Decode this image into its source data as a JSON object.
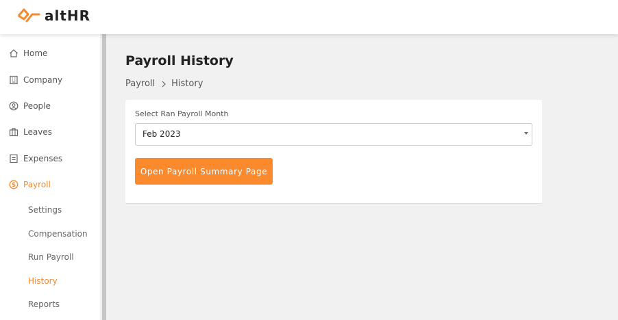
{
  "brand": {
    "name": "altHR",
    "accent": "#f7892b"
  },
  "sidebar": {
    "items": [
      {
        "label": "Home",
        "icon": "home-icon"
      },
      {
        "label": "Company",
        "icon": "building-icon"
      },
      {
        "label": "People",
        "icon": "person-circle-icon"
      },
      {
        "label": "Leaves",
        "icon": "briefcase-icon"
      },
      {
        "label": "Expenses",
        "icon": "document-icon"
      },
      {
        "label": "Payroll",
        "icon": "dollar-circle-icon",
        "active": true
      }
    ],
    "payroll_subitems": [
      {
        "label": "Settings"
      },
      {
        "label": "Compensation"
      },
      {
        "label": "Run Payroll"
      },
      {
        "label": "History",
        "active": true
      },
      {
        "label": "Reports"
      }
    ]
  },
  "main": {
    "title": "Payroll History",
    "breadcrumb": [
      "Payroll",
      "History"
    ],
    "form": {
      "label": "Select Ran Payroll Month",
      "selected_month": "Feb 2023",
      "button_label": "Open Payroll Summary Page"
    }
  }
}
